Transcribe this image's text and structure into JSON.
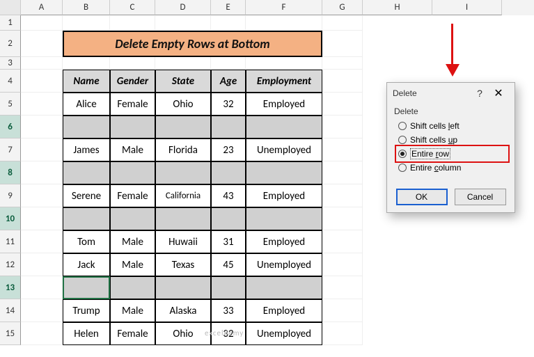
{
  "cols": [
    "A",
    "B",
    "C",
    "D",
    "E",
    "F",
    "G",
    "H",
    "I"
  ],
  "rows": [
    "1",
    "2",
    "3",
    "4",
    "5",
    "6",
    "7",
    "8",
    "9",
    "10",
    "11",
    "12",
    "13",
    "14",
    "15"
  ],
  "selected_rows": [
    "6",
    "8",
    "10",
    "13"
  ],
  "title": "Delete Empty Rows at Bottom",
  "headers": {
    "name": "Name",
    "gender": "Gender",
    "state": "State",
    "age": "Age",
    "employment": "Employment"
  },
  "data": [
    {
      "name": "Alice",
      "gender": "Female",
      "state": "Ohio",
      "age": "32",
      "employment": "Employed"
    },
    {
      "name": "",
      "gender": "",
      "state": "",
      "age": "",
      "employment": ""
    },
    {
      "name": "James",
      "gender": "Male",
      "state": "Florida",
      "age": "23",
      "employment": "Unemployed"
    },
    {
      "name": "",
      "gender": "",
      "state": "",
      "age": "",
      "employment": ""
    },
    {
      "name": "Serene",
      "gender": "Female",
      "state": "California",
      "age": "43",
      "employment": "Employed"
    },
    {
      "name": "",
      "gender": "",
      "state": "",
      "age": "",
      "employment": ""
    },
    {
      "name": "Tom",
      "gender": "Male",
      "state": "Huwaii",
      "age": "31",
      "employment": "Employed"
    },
    {
      "name": "Jack",
      "gender": "Male",
      "state": "Texas",
      "age": "45",
      "employment": "Unemployed"
    },
    {
      "name": "",
      "gender": "",
      "state": "",
      "age": "",
      "employment": ""
    },
    {
      "name": "Trump",
      "gender": "Male",
      "state": "Alaska",
      "age": "33",
      "employment": "Employed"
    },
    {
      "name": "Helen",
      "gender": "Female",
      "state": "Ohio",
      "age": "32",
      "employment": "Unemployed"
    }
  ],
  "dialog": {
    "title": "Delete",
    "group": "Delete",
    "shift_left": "Shift cells left",
    "shift_up": "Shift cells up",
    "entire_row": "Entire row",
    "entire_column": "Entire column",
    "selected": "entire_row",
    "ok": "OK",
    "cancel": "Cancel"
  },
  "watermark": "exceldemy"
}
